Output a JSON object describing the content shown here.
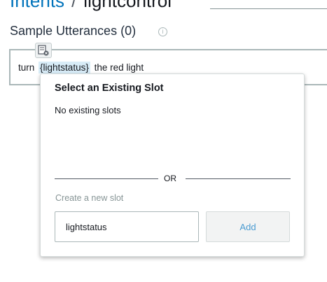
{
  "breadcrumb": {
    "parent_label": "Intents",
    "separator": "/",
    "current_label": "lightcontrol"
  },
  "section": {
    "title": "Sample Utterances (0)",
    "info_icon": "info-icon"
  },
  "utterance": {
    "before": "turn",
    "slot": "{lightstatus}",
    "after": "the red light",
    "slot_tool_icon": "slot-edit-icon"
  },
  "popover": {
    "title": "Select an Existing Slot",
    "empty_message": "No existing slots",
    "divider_text": "OR",
    "create_label": "Create a new slot",
    "input_value": "lightstatus",
    "add_label": "Add"
  },
  "colors": {
    "link": "#0073bb",
    "slot_highlight": "#d8ecf7",
    "add_text": "#4a9bd1"
  }
}
